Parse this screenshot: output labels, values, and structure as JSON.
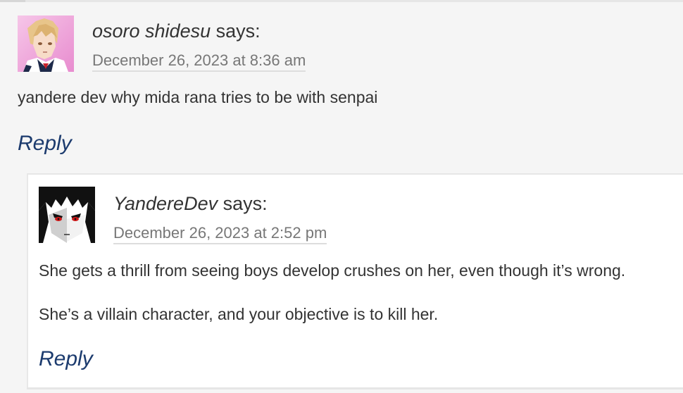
{
  "comments": [
    {
      "author": "osoro shidesu",
      "says": "says:",
      "date": "December 26, 2023 at 8:36 am",
      "paragraphs": [
        "yandere dev why mida rana tries to be with senpai"
      ],
      "reply_label": "Reply",
      "avatar": "anime-girl-avatar-icon"
    },
    {
      "author": "YandereDev",
      "says": "says:",
      "date": "December 26, 2023 at 2:52 pm",
      "paragraphs": [
        "She gets a thrill from seeing boys develop crushes on her, even though it’s wrong.",
        "She’s a villain character, and your objective is to kill her."
      ],
      "reply_label": "Reply",
      "avatar": "red-eyed-character-avatar-icon"
    }
  ],
  "colors": {
    "background": "#f5f5f5",
    "reply_background": "#ffffff",
    "text": "#333333",
    "date": "#777777",
    "link": "#1c3b6e"
  }
}
